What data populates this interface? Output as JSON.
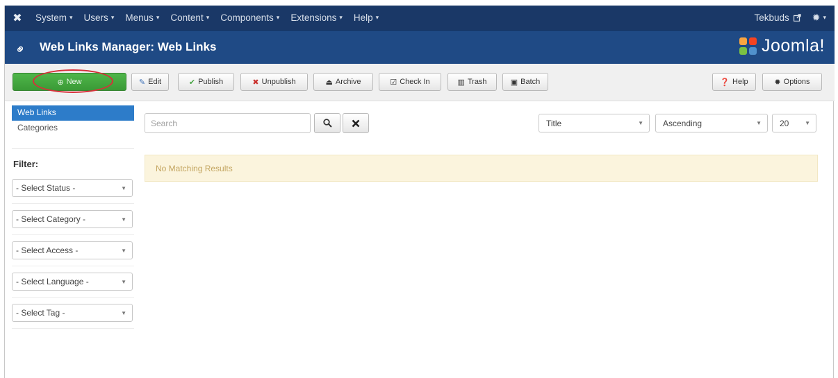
{
  "topnav": {
    "menus": [
      "System",
      "Users",
      "Menus",
      "Content",
      "Components",
      "Extensions",
      "Help"
    ],
    "user": "Tekbuds",
    "icons": {
      "logo": "joomla-icon",
      "external": "external-link-icon",
      "settings": "gear-icon"
    }
  },
  "header": {
    "title": "Web Links Manager: Web Links",
    "brand": "Joomla!",
    "icon": "link-icon"
  },
  "toolbar": {
    "new": "New",
    "edit": "Edit",
    "publish": "Publish",
    "unpublish": "Unpublish",
    "archive": "Archive",
    "checkin": "Check In",
    "trash": "Trash",
    "batch": "Batch",
    "help": "Help",
    "options": "Options"
  },
  "sidebar": {
    "links": [
      "Web Links",
      "Categories"
    ],
    "active": "Web Links",
    "filter_title": "Filter:",
    "filters": [
      "- Select Status -",
      "- Select Category -",
      "- Select Access -",
      "- Select Language -",
      "- Select Tag -"
    ]
  },
  "list": {
    "search_placeholder": "Search",
    "ordering": "Title",
    "direction": "Ascending",
    "limit": "20",
    "empty_message": "No Matching Results"
  },
  "colors": {
    "topnav_bg": "#1a3867",
    "header_bg": "#1f4a85",
    "new_button": "#3a9a36",
    "highlight_oval": "#d7303a",
    "active_link": "#2d7cc9",
    "alert_bg": "#fbf4dd"
  }
}
